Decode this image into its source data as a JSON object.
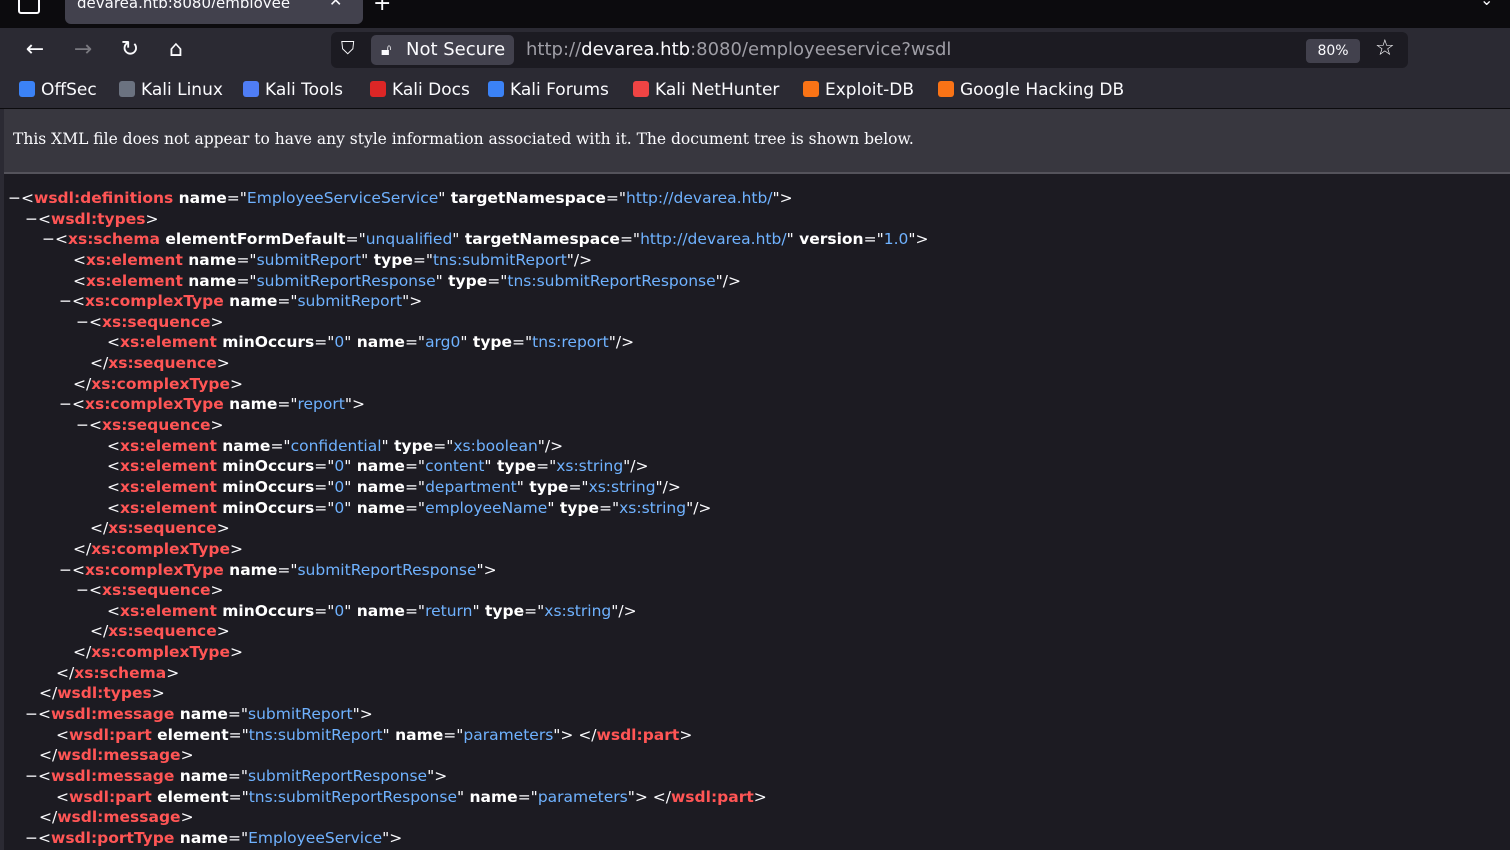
{
  "tab": {
    "title": "devarea.htb:8080/employee",
    "close": "✕",
    "new_tab": "+",
    "list_all": "⌄"
  },
  "nav": {
    "back": "←",
    "forward": "→",
    "reload": "↻",
    "home": "⌂",
    "security_label": "Not Secure",
    "url_prefix": "http://",
    "url_host": "devarea.htb",
    "url_rest": ":8080/employeeservice?wsdl",
    "zoom": "80%",
    "star": "☆"
  },
  "bookmarks": [
    {
      "label": "OffSec",
      "color": "#3b82f6"
    },
    {
      "label": "Kali Linux",
      "color": "#6b7280"
    },
    {
      "label": "Kali Tools",
      "color": "#4f7df5"
    },
    {
      "label": "Kali Docs",
      "color": "#dc2626"
    },
    {
      "label": "Kali Forums",
      "color": "#3b82f6"
    },
    {
      "label": "Kali NetHunter",
      "color": "#ef4444"
    },
    {
      "label": "Exploit-DB",
      "color": "#f97316"
    },
    {
      "label": "Google Hacking DB",
      "color": "#f97316"
    }
  ],
  "info_message": "This XML file does not appear to have any style information associated with it. The document tree is shown below.",
  "xml_lines": [
    {
      "i": 0,
      "c": true,
      "t": [
        [
          "p",
          "<"
        ],
        [
          "g",
          "wsdl:definitions"
        ],
        [
          "a",
          " name"
        ],
        [
          "p",
          "=\""
        ],
        [
          "v",
          "EmployeeServiceService"
        ],
        [
          "p",
          "\""
        ],
        [
          "a",
          " targetNamespace"
        ],
        [
          "p",
          "=\""
        ],
        [
          "v",
          "http://devarea.htb/"
        ],
        [
          "p",
          "\">"
        ]
      ]
    },
    {
      "i": 1,
      "c": true,
      "t": [
        [
          "p",
          "<"
        ],
        [
          "g",
          "wsdl:types"
        ],
        [
          "p",
          ">"
        ]
      ]
    },
    {
      "i": 2,
      "c": true,
      "t": [
        [
          "p",
          "<"
        ],
        [
          "g",
          "xs:schema"
        ],
        [
          "a",
          " elementFormDefault"
        ],
        [
          "p",
          "=\""
        ],
        [
          "v",
          "unqualified"
        ],
        [
          "p",
          "\""
        ],
        [
          "a",
          " targetNamespace"
        ],
        [
          "p",
          "=\""
        ],
        [
          "v",
          "http://devarea.htb/"
        ],
        [
          "p",
          "\""
        ],
        [
          "a",
          " version"
        ],
        [
          "p",
          "=\""
        ],
        [
          "v",
          "1.0"
        ],
        [
          "p",
          "\">"
        ]
      ]
    },
    {
      "i": 3,
      "c": false,
      "t": [
        [
          "p",
          "<"
        ],
        [
          "g",
          "xs:element"
        ],
        [
          "a",
          " name"
        ],
        [
          "p",
          "=\""
        ],
        [
          "v",
          "submitReport"
        ],
        [
          "p",
          "\""
        ],
        [
          "a",
          " type"
        ],
        [
          "p",
          "=\""
        ],
        [
          "v",
          "tns:submitReport"
        ],
        [
          "p",
          "\"/>"
        ]
      ]
    },
    {
      "i": 3,
      "c": false,
      "t": [
        [
          "p",
          "<"
        ],
        [
          "g",
          "xs:element"
        ],
        [
          "a",
          " name"
        ],
        [
          "p",
          "=\""
        ],
        [
          "v",
          "submitReportResponse"
        ],
        [
          "p",
          "\""
        ],
        [
          "a",
          " type"
        ],
        [
          "p",
          "=\""
        ],
        [
          "v",
          "tns:submitReportResponse"
        ],
        [
          "p",
          "\"/>"
        ]
      ]
    },
    {
      "i": 3,
      "c": true,
      "t": [
        [
          "p",
          "<"
        ],
        [
          "g",
          "xs:complexType"
        ],
        [
          "a",
          " name"
        ],
        [
          "p",
          "=\""
        ],
        [
          "v",
          "submitReport"
        ],
        [
          "p",
          "\">"
        ]
      ]
    },
    {
      "i": 4,
      "c": true,
      "t": [
        [
          "p",
          "<"
        ],
        [
          "g",
          "xs:sequence"
        ],
        [
          "p",
          ">"
        ]
      ]
    },
    {
      "i": 5,
      "c": false,
      "t": [
        [
          "p",
          "<"
        ],
        [
          "g",
          "xs:element"
        ],
        [
          "a",
          " minOccurs"
        ],
        [
          "p",
          "=\""
        ],
        [
          "v",
          "0"
        ],
        [
          "p",
          "\""
        ],
        [
          "a",
          " name"
        ],
        [
          "p",
          "=\""
        ],
        [
          "v",
          "arg0"
        ],
        [
          "p",
          "\""
        ],
        [
          "a",
          " type"
        ],
        [
          "p",
          "=\""
        ],
        [
          "v",
          "tns:report"
        ],
        [
          "p",
          "\"/>"
        ]
      ]
    },
    {
      "i": 4,
      "c": false,
      "t": [
        [
          "p",
          "</"
        ],
        [
          "g",
          "xs:sequence"
        ],
        [
          "p",
          ">"
        ]
      ]
    },
    {
      "i": 3,
      "c": false,
      "t": [
        [
          "p",
          "</"
        ],
        [
          "g",
          "xs:complexType"
        ],
        [
          "p",
          ">"
        ]
      ]
    },
    {
      "i": 3,
      "c": true,
      "t": [
        [
          "p",
          "<"
        ],
        [
          "g",
          "xs:complexType"
        ],
        [
          "a",
          " name"
        ],
        [
          "p",
          "=\""
        ],
        [
          "v",
          "report"
        ],
        [
          "p",
          "\">"
        ]
      ]
    },
    {
      "i": 4,
      "c": true,
      "t": [
        [
          "p",
          "<"
        ],
        [
          "g",
          "xs:sequence"
        ],
        [
          "p",
          ">"
        ]
      ]
    },
    {
      "i": 5,
      "c": false,
      "t": [
        [
          "p",
          "<"
        ],
        [
          "g",
          "xs:element"
        ],
        [
          "a",
          " name"
        ],
        [
          "p",
          "=\""
        ],
        [
          "v",
          "confidential"
        ],
        [
          "p",
          "\""
        ],
        [
          "a",
          " type"
        ],
        [
          "p",
          "=\""
        ],
        [
          "v",
          "xs:boolean"
        ],
        [
          "p",
          "\"/>"
        ]
      ]
    },
    {
      "i": 5,
      "c": false,
      "t": [
        [
          "p",
          "<"
        ],
        [
          "g",
          "xs:element"
        ],
        [
          "a",
          " minOccurs"
        ],
        [
          "p",
          "=\""
        ],
        [
          "v",
          "0"
        ],
        [
          "p",
          "\""
        ],
        [
          "a",
          " name"
        ],
        [
          "p",
          "=\""
        ],
        [
          "v",
          "content"
        ],
        [
          "p",
          "\""
        ],
        [
          "a",
          " type"
        ],
        [
          "p",
          "=\""
        ],
        [
          "v",
          "xs:string"
        ],
        [
          "p",
          "\"/>"
        ]
      ]
    },
    {
      "i": 5,
      "c": false,
      "t": [
        [
          "p",
          "<"
        ],
        [
          "g",
          "xs:element"
        ],
        [
          "a",
          " minOccurs"
        ],
        [
          "p",
          "=\""
        ],
        [
          "v",
          "0"
        ],
        [
          "p",
          "\""
        ],
        [
          "a",
          " name"
        ],
        [
          "p",
          "=\""
        ],
        [
          "v",
          "department"
        ],
        [
          "p",
          "\""
        ],
        [
          "a",
          " type"
        ],
        [
          "p",
          "=\""
        ],
        [
          "v",
          "xs:string"
        ],
        [
          "p",
          "\"/>"
        ]
      ]
    },
    {
      "i": 5,
      "c": false,
      "t": [
        [
          "p",
          "<"
        ],
        [
          "g",
          "xs:element"
        ],
        [
          "a",
          " minOccurs"
        ],
        [
          "p",
          "=\""
        ],
        [
          "v",
          "0"
        ],
        [
          "p",
          "\""
        ],
        [
          "a",
          " name"
        ],
        [
          "p",
          "=\""
        ],
        [
          "v",
          "employeeName"
        ],
        [
          "p",
          "\""
        ],
        [
          "a",
          " type"
        ],
        [
          "p",
          "=\""
        ],
        [
          "v",
          "xs:string"
        ],
        [
          "p",
          "\"/>"
        ]
      ]
    },
    {
      "i": 4,
      "c": false,
      "t": [
        [
          "p",
          "</"
        ],
        [
          "g",
          "xs:sequence"
        ],
        [
          "p",
          ">"
        ]
      ]
    },
    {
      "i": 3,
      "c": false,
      "t": [
        [
          "p",
          "</"
        ],
        [
          "g",
          "xs:complexType"
        ],
        [
          "p",
          ">"
        ]
      ]
    },
    {
      "i": 3,
      "c": true,
      "t": [
        [
          "p",
          "<"
        ],
        [
          "g",
          "xs:complexType"
        ],
        [
          "a",
          " name"
        ],
        [
          "p",
          "=\""
        ],
        [
          "v",
          "submitReportResponse"
        ],
        [
          "p",
          "\">"
        ]
      ]
    },
    {
      "i": 4,
      "c": true,
      "t": [
        [
          "p",
          "<"
        ],
        [
          "g",
          "xs:sequence"
        ],
        [
          "p",
          ">"
        ]
      ]
    },
    {
      "i": 5,
      "c": false,
      "t": [
        [
          "p",
          "<"
        ],
        [
          "g",
          "xs:element"
        ],
        [
          "a",
          " minOccurs"
        ],
        [
          "p",
          "=\""
        ],
        [
          "v",
          "0"
        ],
        [
          "p",
          "\""
        ],
        [
          "a",
          " name"
        ],
        [
          "p",
          "=\""
        ],
        [
          "v",
          "return"
        ],
        [
          "p",
          "\""
        ],
        [
          "a",
          " type"
        ],
        [
          "p",
          "=\""
        ],
        [
          "v",
          "xs:string"
        ],
        [
          "p",
          "\"/>"
        ]
      ]
    },
    {
      "i": 4,
      "c": false,
      "t": [
        [
          "p",
          "</"
        ],
        [
          "g",
          "xs:sequence"
        ],
        [
          "p",
          ">"
        ]
      ]
    },
    {
      "i": 3,
      "c": false,
      "t": [
        [
          "p",
          "</"
        ],
        [
          "g",
          "xs:complexType"
        ],
        [
          "p",
          ">"
        ]
      ]
    },
    {
      "i": 2,
      "c": false,
      "t": [
        [
          "p",
          "</"
        ],
        [
          "g",
          "xs:schema"
        ],
        [
          "p",
          ">"
        ]
      ]
    },
    {
      "i": 1,
      "c": false,
      "t": [
        [
          "p",
          "</"
        ],
        [
          "g",
          "wsdl:types"
        ],
        [
          "p",
          ">"
        ]
      ]
    },
    {
      "i": 1,
      "c": true,
      "t": [
        [
          "p",
          "<"
        ],
        [
          "g",
          "wsdl:message"
        ],
        [
          "a",
          " name"
        ],
        [
          "p",
          "=\""
        ],
        [
          "v",
          "submitReport"
        ],
        [
          "p",
          "\">"
        ]
      ]
    },
    {
      "i": 2,
      "c": false,
      "t": [
        [
          "p",
          "<"
        ],
        [
          "g",
          "wsdl:part"
        ],
        [
          "a",
          " element"
        ],
        [
          "p",
          "=\""
        ],
        [
          "v",
          "tns:submitReport"
        ],
        [
          "p",
          "\""
        ],
        [
          "a",
          " name"
        ],
        [
          "p",
          "=\""
        ],
        [
          "v",
          "parameters"
        ],
        [
          "p",
          "\"> </"
        ],
        [
          "g",
          "wsdl:part"
        ],
        [
          "p",
          ">"
        ]
      ]
    },
    {
      "i": 1,
      "c": false,
      "t": [
        [
          "p",
          "</"
        ],
        [
          "g",
          "wsdl:message"
        ],
        [
          "p",
          ">"
        ]
      ]
    },
    {
      "i": 1,
      "c": true,
      "t": [
        [
          "p",
          "<"
        ],
        [
          "g",
          "wsdl:message"
        ],
        [
          "a",
          " name"
        ],
        [
          "p",
          "=\""
        ],
        [
          "v",
          "submitReportResponse"
        ],
        [
          "p",
          "\">"
        ]
      ]
    },
    {
      "i": 2,
      "c": false,
      "t": [
        [
          "p",
          "<"
        ],
        [
          "g",
          "wsdl:part"
        ],
        [
          "a",
          " element"
        ],
        [
          "p",
          "=\""
        ],
        [
          "v",
          "tns:submitReportResponse"
        ],
        [
          "p",
          "\""
        ],
        [
          "a",
          " name"
        ],
        [
          "p",
          "=\""
        ],
        [
          "v",
          "parameters"
        ],
        [
          "p",
          "\"> </"
        ],
        [
          "g",
          "wsdl:part"
        ],
        [
          "p",
          ">"
        ]
      ]
    },
    {
      "i": 1,
      "c": false,
      "t": [
        [
          "p",
          "</"
        ],
        [
          "g",
          "wsdl:message"
        ],
        [
          "p",
          ">"
        ]
      ]
    },
    {
      "i": 1,
      "c": true,
      "t": [
        [
          "p",
          "<"
        ],
        [
          "g",
          "wsdl:portType"
        ],
        [
          "a",
          " name"
        ],
        [
          "p",
          "=\""
        ],
        [
          "v",
          "EmployeeService"
        ],
        [
          "p",
          "\">"
        ]
      ]
    }
  ]
}
